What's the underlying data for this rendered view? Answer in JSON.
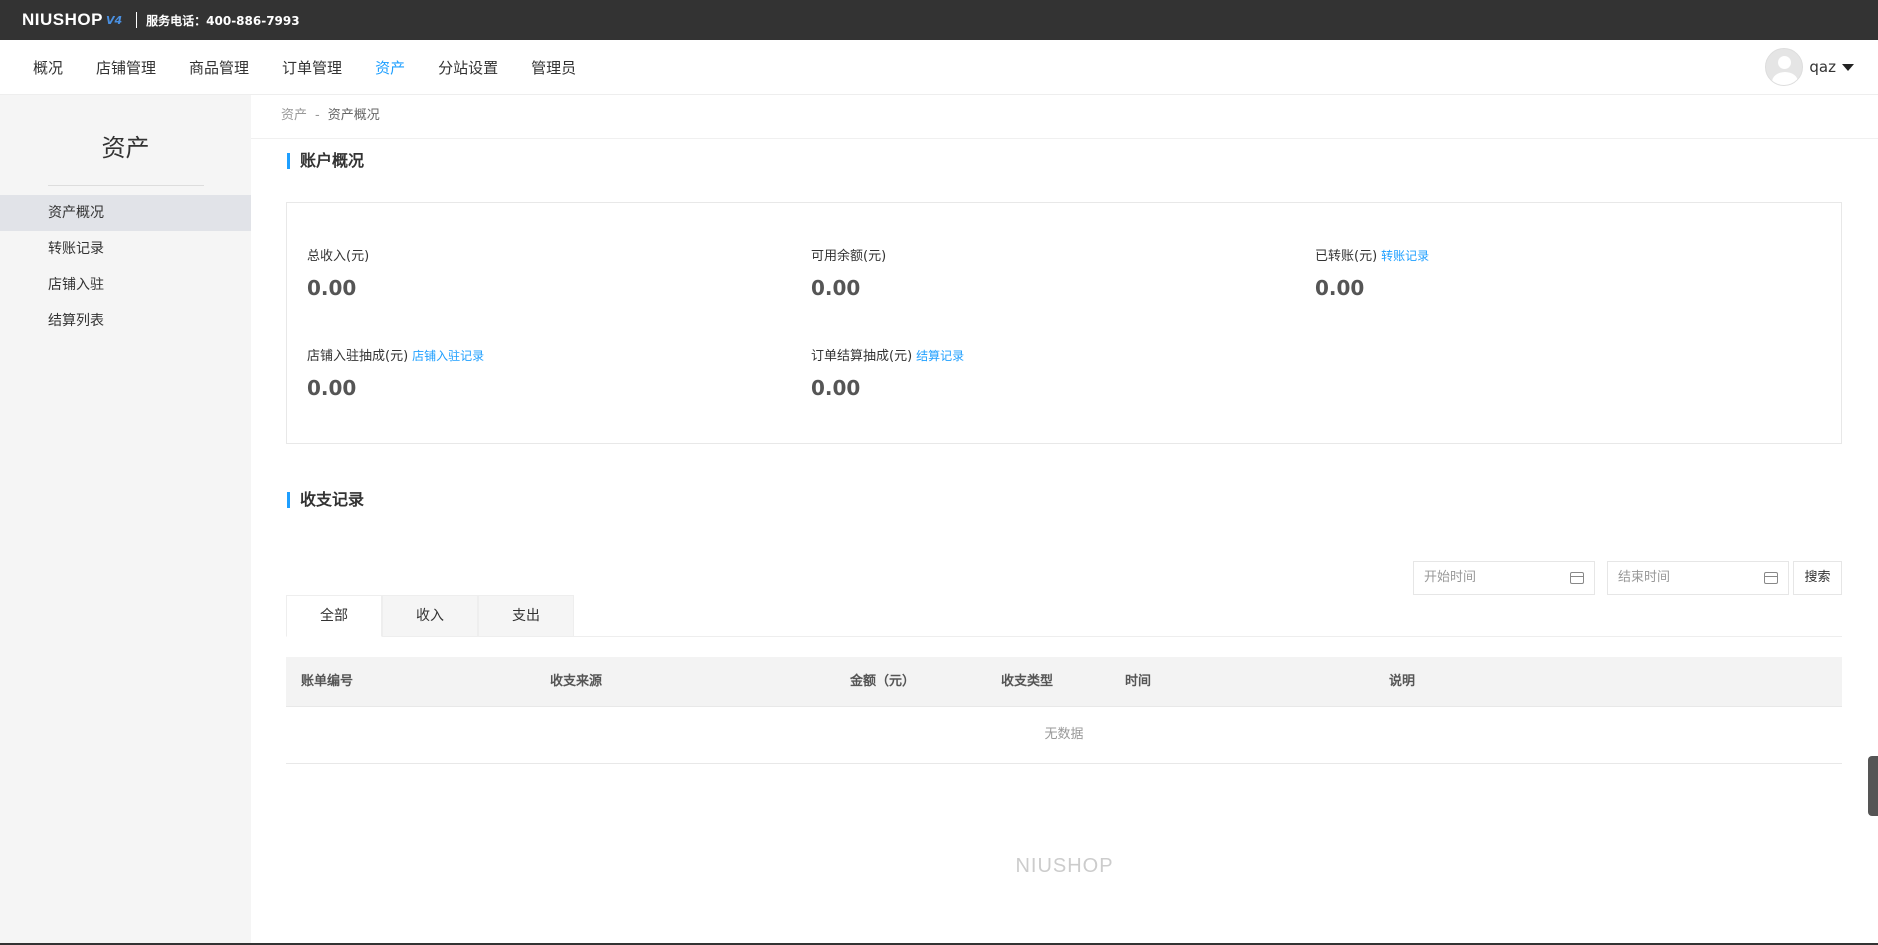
{
  "topbar": {
    "logo": "NIUSHOP",
    "logo_version": "V4",
    "hotline": "服务电话：400-886-7993"
  },
  "nav": {
    "items": [
      {
        "label": "概况",
        "active": false
      },
      {
        "label": "店铺管理",
        "active": false
      },
      {
        "label": "商品管理",
        "active": false
      },
      {
        "label": "订单管理",
        "active": false
      },
      {
        "label": "资产",
        "active": true
      },
      {
        "label": "分站设置",
        "active": false
      },
      {
        "label": "管理员",
        "active": false
      }
    ],
    "username": "qaz"
  },
  "sidebar": {
    "title": "资产",
    "items": [
      {
        "label": "资产概况",
        "active": true
      },
      {
        "label": "转账记录",
        "active": false
      },
      {
        "label": "店铺入驻",
        "active": false
      },
      {
        "label": "结算列表",
        "active": false
      }
    ]
  },
  "breadcrumb": {
    "parent": "资产",
    "separator": "-",
    "current": "资产概况"
  },
  "overview": {
    "title": "账户概况",
    "stats": [
      {
        "label": "总收入(元)",
        "value": "0.00",
        "link": ""
      },
      {
        "label": "可用余额(元)",
        "value": "0.00",
        "link": ""
      },
      {
        "label": "已转账(元)",
        "value": "0.00",
        "link": "转账记录"
      },
      {
        "label": "店铺入驻抽成(元)",
        "value": "0.00",
        "link": "店铺入驻记录"
      },
      {
        "label": "订单结算抽成(元)",
        "value": "0.00",
        "link": "结算记录"
      }
    ]
  },
  "records": {
    "title": "收支记录",
    "start_placeholder": "开始时间",
    "end_placeholder": "结束时间",
    "search_label": "搜索",
    "tabs": [
      {
        "label": "全部",
        "active": true
      },
      {
        "label": "收入",
        "active": false
      },
      {
        "label": "支出",
        "active": false
      }
    ],
    "columns": [
      "账单编号",
      "收支来源",
      "金额（元）",
      "收支类型",
      "时间",
      "说明"
    ],
    "empty_text": "无数据"
  },
  "footer": {
    "logo": "NIUSHOP"
  },
  "colors": {
    "accent": "#1e9fff",
    "topbar": "#333333",
    "sidebar_bg": "#f5f5f5"
  }
}
